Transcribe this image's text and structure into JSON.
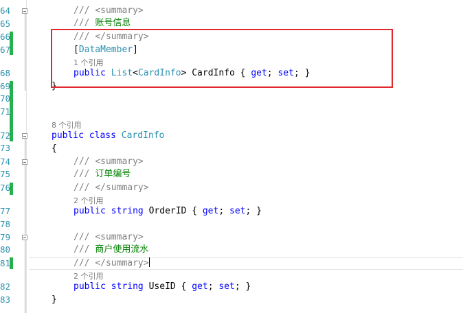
{
  "editor": {
    "line_numbers": [
      "64",
      "65",
      "66",
      "67",
      "68",
      "69",
      "70",
      "71",
      "72",
      "73",
      "74",
      "75",
      "76",
      "77",
      "78",
      "79",
      "80",
      "81",
      "82",
      "83"
    ],
    "code_lens": {
      "one_ref": "1 个引用",
      "eight_ref": "8 个引用",
      "two_ref": "2 个引用"
    },
    "tokens": {
      "doc_prefix": "/// ",
      "summary_open": "<summary>",
      "summary_close": "</summary>",
      "comment_account": "账号信息",
      "comment_order_number": "订单编号",
      "comment_merchant_flow": "商户使用流水",
      "attr_open": "[",
      "attr_name": "DataMember",
      "attr_close": "]",
      "kw_public": "public",
      "kw_class": "class",
      "kw_string": "string",
      "kw_get": "get",
      "kw_set": "set",
      "type_list": "List",
      "type_cardinfo": "CardInfo",
      "lt": "<",
      "gt": ">",
      "prop_cardinfo": " CardInfo { ",
      "prop_orderid": " OrderID { ",
      "prop_useid": " UseID { ",
      "semi_sp": "; ",
      "semi_close": "; }",
      "brace_open": "{",
      "brace_close": "}"
    },
    "colors": {
      "keyword": "#0000ff",
      "type": "#2b91af",
      "comment": "#008000",
      "doc_tag": "#808080",
      "change_marker": "#22b14c",
      "highlight_box": "#e0282e"
    }
  }
}
